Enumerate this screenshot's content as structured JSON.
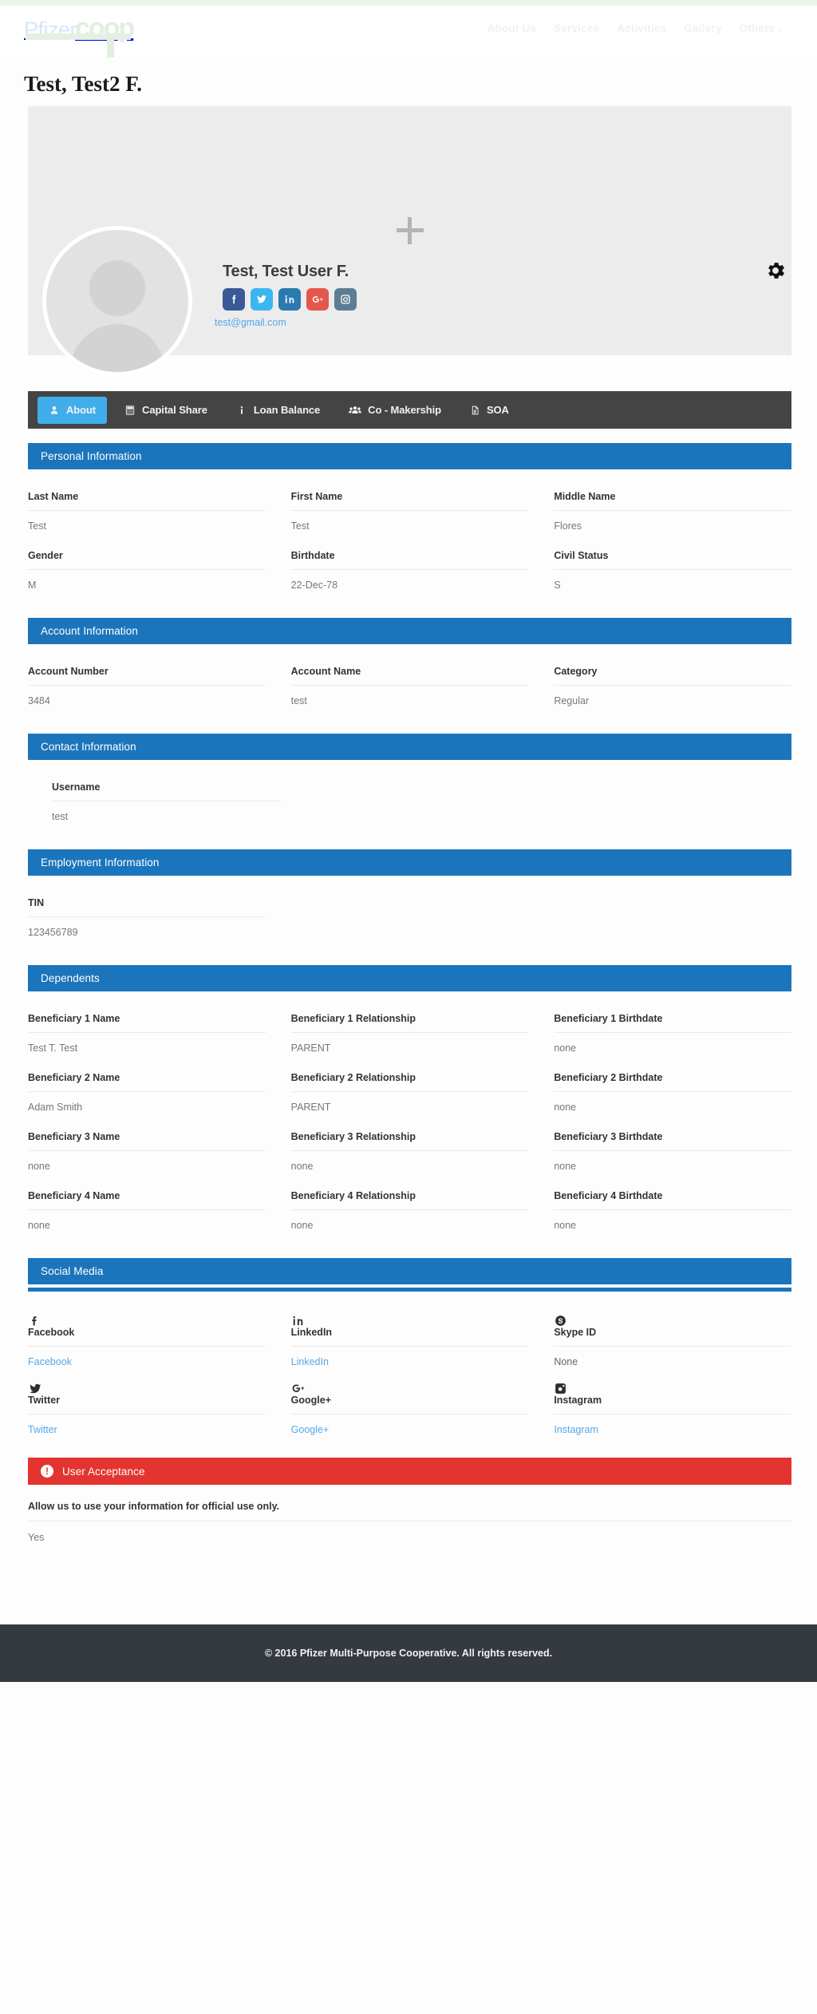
{
  "header": {
    "logo_primary": "Pfizer",
    "logo_secondary": "coop",
    "nav": [
      {
        "label": "About Us"
      },
      {
        "label": "Services"
      },
      {
        "label": "Activities"
      },
      {
        "label": "Gallery"
      },
      {
        "label": "Others",
        "caret": "⌄"
      }
    ]
  },
  "page_title": "Test, Test2 F.",
  "profile": {
    "cover_add_label": "+",
    "display_name": "Test, Test User F.",
    "email": "test@gmail.com",
    "social_buttons": [
      {
        "name": "facebook",
        "color": "#3b5998"
      },
      {
        "name": "twitter",
        "color": "#3cb6f0"
      },
      {
        "name": "linkedin",
        "color": "#2a7ab0"
      },
      {
        "name": "googleplus",
        "color": "#e4584b"
      },
      {
        "name": "instagram",
        "color": "#5d7d94"
      }
    ],
    "settings_icon": "gear-icon"
  },
  "tabs": [
    {
      "label": "About",
      "icon": "user-icon",
      "active": true
    },
    {
      "label": "Capital Share",
      "icon": "calculator-icon",
      "active": false
    },
    {
      "label": "Loan Balance",
      "icon": "info-icon",
      "active": false
    },
    {
      "label": "Co - Makership",
      "icon": "users-icon",
      "active": false
    },
    {
      "label": "SOA",
      "icon": "file-icon",
      "active": false
    }
  ],
  "sections": {
    "personal": {
      "title": "Personal Information",
      "fields": [
        {
          "label": "Last Name",
          "value": "Test"
        },
        {
          "label": "First Name",
          "value": "Test"
        },
        {
          "label": "Middle Name",
          "value": "Flores"
        },
        {
          "label": "Gender",
          "value": "M"
        },
        {
          "label": "Birthdate",
          "value": "22-Dec-78"
        },
        {
          "label": "Civil Status",
          "value": "S"
        }
      ]
    },
    "account": {
      "title": "Account Information",
      "fields": [
        {
          "label": "Account Number",
          "value": "3484"
        },
        {
          "label": "Account Name",
          "value": "test"
        },
        {
          "label": "Category",
          "value": "Regular"
        }
      ]
    },
    "contact": {
      "title": "Contact Information",
      "fields": [
        {
          "label": "Username",
          "value": "test"
        }
      ]
    },
    "employment": {
      "title": "Employment Information",
      "fields": [
        {
          "label": "TIN",
          "value": "123456789"
        }
      ]
    },
    "dependents": {
      "title": "Dependents",
      "fields": [
        {
          "label": "Beneficiary 1 Name",
          "value": "Test T. Test"
        },
        {
          "label": "Beneficiary 1 Relationship",
          "value": "PARENT"
        },
        {
          "label": "Beneficiary 1 Birthdate",
          "value": "none"
        },
        {
          "label": "Beneficiary 2 Name",
          "value": "Adam Smith"
        },
        {
          "label": "Beneficiary 2 Relationship",
          "value": "PARENT"
        },
        {
          "label": "Beneficiary 2 Birthdate",
          "value": "none"
        },
        {
          "label": "Beneficiary 3 Name",
          "value": "none"
        },
        {
          "label": "Beneficiary 3 Relationship",
          "value": "none"
        },
        {
          "label": "Beneficiary 3 Birthdate",
          "value": "none"
        },
        {
          "label": "Beneficiary 4 Name",
          "value": "none"
        },
        {
          "label": "Beneficiary 4 Relationship",
          "value": "none"
        },
        {
          "label": "Beneficiary 4 Birthdate",
          "value": "none"
        }
      ]
    },
    "social_media": {
      "title": "Social Media",
      "items": [
        {
          "icon": "facebook-icon",
          "name": "Facebook",
          "value": "Facebook",
          "is_link": true
        },
        {
          "icon": "linkedin-icon",
          "name": "LinkedIn",
          "value": "LinkedIn",
          "is_link": true
        },
        {
          "icon": "skype-icon",
          "name": "Skype ID",
          "value": "None",
          "is_link": false
        },
        {
          "icon": "twitter-icon",
          "name": "Twitter",
          "value": "Twitter",
          "is_link": true
        },
        {
          "icon": "googleplus-icon",
          "name": "Google+",
          "value": "Google+",
          "is_link": true
        },
        {
          "icon": "instagram-icon",
          "name": "Instagram",
          "value": "Instagram",
          "is_link": true
        }
      ]
    },
    "user_acceptance": {
      "title": "User Acceptance",
      "question": "Allow us to use your information for official use only.",
      "answer": "Yes"
    }
  },
  "footer": {
    "copyright": "© 2016 Pfizer Multi-Purpose Cooperative. All rights reserved."
  },
  "colors": {
    "section_blue": "#1b75bc",
    "alert_red": "#e3342f",
    "tab_active": "#40aeeb",
    "link_blue": "#56a8e8",
    "footer_dark": "#343a40"
  }
}
